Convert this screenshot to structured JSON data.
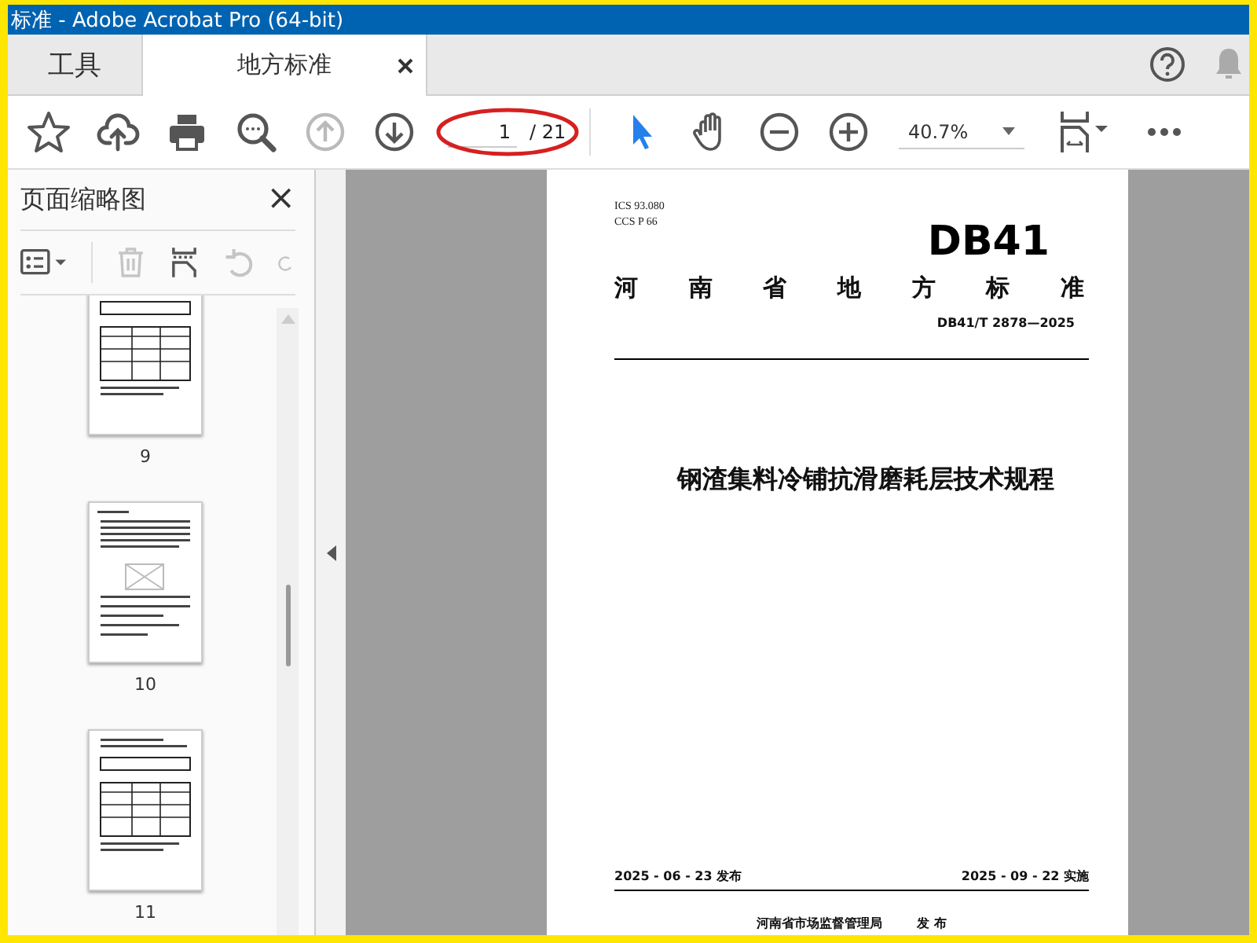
{
  "window": {
    "title": "标准 - Adobe Acrobat Pro (64-bit)"
  },
  "tabs": [
    {
      "label": "工具",
      "selected": false,
      "closable": false
    },
    {
      "label": "地方标准",
      "selected": true,
      "closable": true
    }
  ],
  "toolbar": {
    "left_buttons": [
      {
        "kind": "star",
        "disabled": false
      },
      {
        "kind": "upload",
        "disabled": false
      },
      {
        "kind": "print",
        "disabled": false
      },
      {
        "kind": "zoom-search",
        "disabled": false
      },
      {
        "kind": "prev-page",
        "disabled": true
      },
      {
        "kind": "next-page",
        "disabled": false
      }
    ],
    "page_number": "1",
    "page_total": "/ 21",
    "tool_buttons": [
      {
        "kind": "select",
        "selected": true
      },
      {
        "kind": "hand",
        "selected": false
      },
      {
        "kind": "zoom-out",
        "selected": false
      },
      {
        "kind": "zoom-in",
        "selected": false
      }
    ],
    "zoom": "40.7%"
  },
  "sidebar": {
    "title": "页面缩略图",
    "close": "×",
    "tools": [
      {
        "kind": "options",
        "disabled": false
      },
      {
        "kind": "delete",
        "disabled": true
      },
      {
        "kind": "insert",
        "disabled": false
      },
      {
        "kind": "rotate-left",
        "disabled": true
      },
      {
        "kind": "rotate-right",
        "disabled": true
      }
    ],
    "thumbnails": [
      {
        "label": "9",
        "kind": "tables"
      },
      {
        "label": "10",
        "kind": "figure"
      },
      {
        "label": "11",
        "kind": "tables"
      }
    ]
  },
  "document": {
    "ics": "ICS  93.080",
    "ccs": "CCS  P 66",
    "logo": "DB41",
    "category": "河 南 省 地 方 标 准",
    "code": "DB41/T 2878—2025",
    "title": "钢渣集料冷铺抗滑磨耗层技术规程",
    "issue_date": "2025 - 06 - 23 发布",
    "effective_date": "2025 - 09 - 22 实施",
    "publisher": "河南省市场监督管理局",
    "publish": "发  布"
  }
}
